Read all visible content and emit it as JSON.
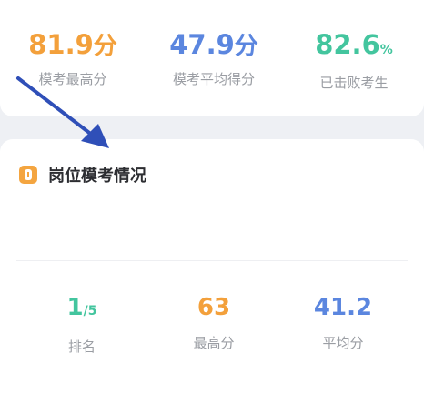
{
  "summary": {
    "items": [
      {
        "value": "81.9",
        "unit": "分",
        "label": "模考最高分",
        "color": "#f3a03b"
      },
      {
        "value": "47.9",
        "unit": "分",
        "label": "模考平均得分",
        "color": "#5b86df"
      },
      {
        "value": "82.6",
        "unit": "%",
        "label": "已击败考生",
        "color": "#43c59e"
      }
    ]
  },
  "section": {
    "title": "岗位模考情况",
    "icon": "document-icon",
    "stats": [
      {
        "value": "1",
        "suffix": "/5",
        "label": "排名",
        "color": "#43c59e"
      },
      {
        "value": "63",
        "label": "最高分",
        "color": "#f3a03b"
      },
      {
        "value": "41.2",
        "label": "平均分",
        "color": "#5b86df"
      }
    ]
  },
  "overlay": {
    "arrow_color": "#2f4fb8"
  }
}
